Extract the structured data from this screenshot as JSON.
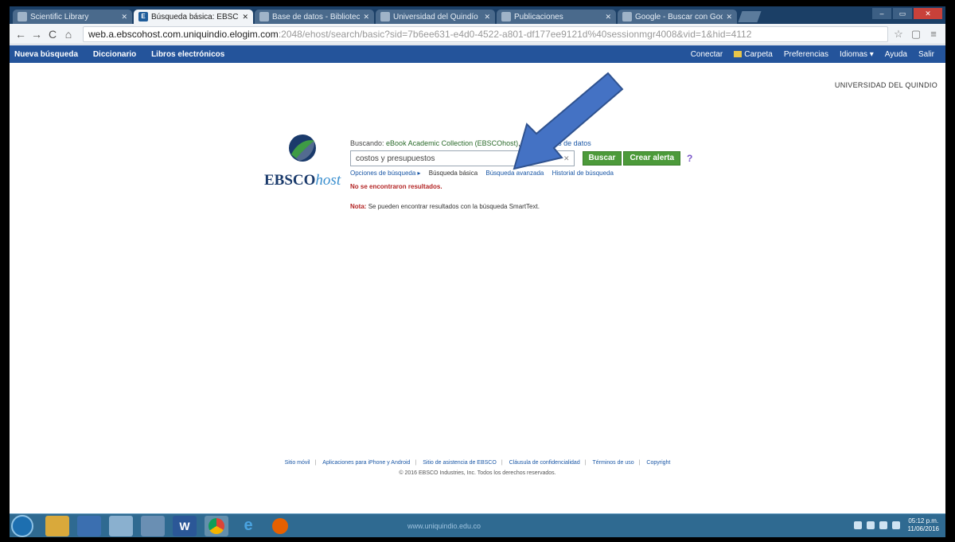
{
  "browser": {
    "tabs": [
      {
        "label": "Scientific Library",
        "active": false
      },
      {
        "label": "Búsqueda básica: EBSCOhost",
        "active": true
      },
      {
        "label": "Base de datos - Biblioteca",
        "active": false
      },
      {
        "label": "Universidad del Quindío",
        "active": false
      },
      {
        "label": "Publicaciones",
        "active": false
      },
      {
        "label": "Google - Buscar con Google",
        "active": false
      }
    ],
    "url_host": "web.a.ebscohost.com.uniquindio.elogim.com",
    "url_path": ":2048/ehost/search/basic?sid=7b6ee631-e4d0-4522-a801-df177ee9121d%40sessionmgr4008&vid=1&hid=4112"
  },
  "toolbar": {
    "left": [
      "Nueva búsqueda",
      "Diccionario",
      "Libros electrónicos"
    ],
    "right": [
      "Conectar",
      "Carpeta",
      "Preferencias",
      "Idiomas ▾",
      "Ayuda",
      "Salir"
    ]
  },
  "institution": "UNIVERSIDAD DEL QUINDIO",
  "logo": {
    "ebsco": "EBSCO",
    "host": "host"
  },
  "search": {
    "searching_prefix": "Buscando:",
    "database": "eBook Academic Collection (EBSCOhost)",
    "choose_db": "Elegir bases de datos",
    "query": "costos y presupuestos",
    "search_button": "Buscar",
    "alert_button": "Crear alerta",
    "help": "?",
    "links": [
      "Opciones de búsqueda ▸",
      "Búsqueda básica",
      "Búsqueda avanzada",
      "Historial de búsqueda"
    ],
    "no_results": "No se encontraron resultados.",
    "note_label": "Nota:",
    "note_text": "Se pueden encontrar resultados con la búsqueda SmartText."
  },
  "footer": {
    "links": [
      "Sitio móvil",
      "Aplicaciones para iPhone y Android",
      "Sitio de asistencia de EBSCO",
      "Cláusula de confidencialidad",
      "Términos de uso",
      "Copyright"
    ],
    "copyright": "© 2016 EBSCO Industries, Inc. Todos los derechos reservados."
  },
  "taskbar": {
    "center_text": "www.uniquindio.edu.co",
    "time": "05:12 p.m.",
    "date": "11/06/2016"
  },
  "colors": {
    "toolbar_blue": "#24549b",
    "button_green": "#4c9a3a",
    "error_red": "#b32424",
    "arrow_fill": "#4472c4"
  }
}
